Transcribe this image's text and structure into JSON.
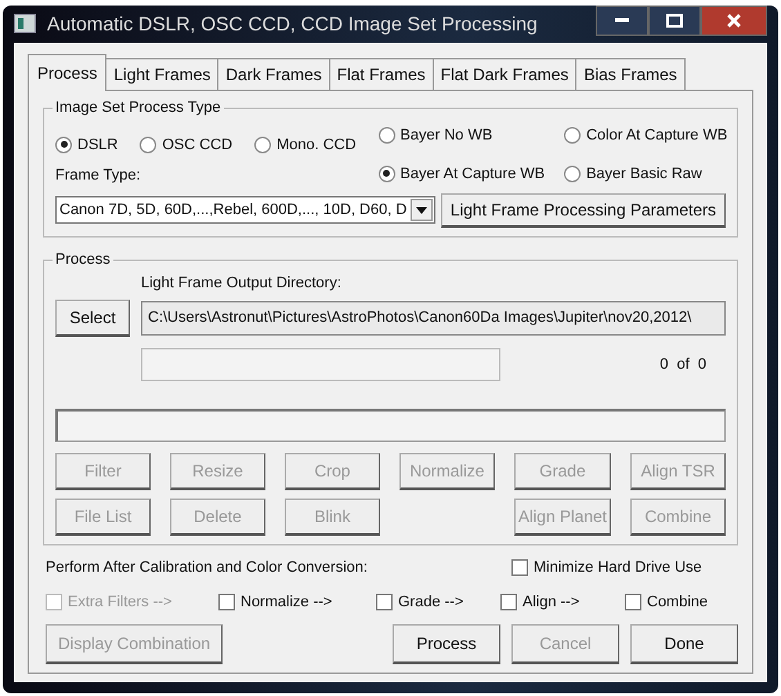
{
  "window": {
    "title": "Automatic DSLR, OSC CCD, CCD Image Set Processing"
  },
  "tabs": [
    {
      "label": "Process",
      "selected": true
    },
    {
      "label": "Light Frames",
      "selected": false
    },
    {
      "label": "Dark Frames",
      "selected": false
    },
    {
      "label": "Flat Frames",
      "selected": false
    },
    {
      "label": "Flat Dark Frames",
      "selected": false
    },
    {
      "label": "Bias Frames",
      "selected": false
    }
  ],
  "image_set_process_type": {
    "legend": "Image Set Process Type",
    "camera_types": [
      {
        "label": "DSLR",
        "selected": true
      },
      {
        "label": "OSC CCD",
        "selected": false
      },
      {
        "label": "Mono. CCD",
        "selected": false
      }
    ],
    "bayer_modes": [
      {
        "label": "Bayer No WB",
        "selected": false
      },
      {
        "label": "Color At Capture WB",
        "selected": false
      },
      {
        "label": "Bayer At Capture WB",
        "selected": true
      },
      {
        "label": "Bayer Basic Raw",
        "selected": false
      }
    ],
    "frame_type_label": "Frame Type:",
    "frame_type_value": "Canon 7D, 5D, 60D,...,Rebel, 600D,..., 10D, D60, D",
    "parameters_button": "Light Frame Processing Parameters"
  },
  "process": {
    "legend": "Process",
    "select_button": "Select",
    "output_dir_label": "Light Frame Output Directory:",
    "output_dir_value": "C:\\Users\\Astronut\\Pictures\\AstroPhotos\\Canon60Da Images\\Jupiter\\nov20,2012\\",
    "progress": {
      "level": 0
    },
    "counter": "0  of  0",
    "button_rows": [
      [
        {
          "label": "Filter",
          "disabled": true
        },
        {
          "label": "Resize",
          "disabled": true
        },
        {
          "label": "Crop",
          "disabled": true
        },
        {
          "label": "Normalize",
          "disabled": true
        },
        {
          "label": "Grade",
          "disabled": true
        },
        {
          "label": "Align TSR",
          "disabled": true
        }
      ],
      [
        {
          "label": "File List",
          "disabled": true
        },
        {
          "label": "Delete",
          "disabled": true
        },
        {
          "label": "Blink",
          "disabled": true
        },
        null,
        {
          "label": "Align Planet",
          "disabled": true
        },
        {
          "label": "Combine",
          "disabled": true
        }
      ]
    ]
  },
  "after_calibration": {
    "label": "Perform After Calibration and Color Conversion:",
    "minimize": {
      "label": "Minimize Hard Drive Use",
      "checked": false
    },
    "checks": [
      {
        "label": "Extra Filters -->",
        "checked": false,
        "disabled": true
      },
      {
        "label": "Normalize  -->",
        "checked": false,
        "disabled": false
      },
      {
        "label": "Grade -->",
        "checked": false,
        "disabled": false
      },
      {
        "label": "Align -->",
        "checked": false,
        "disabled": false
      },
      {
        "label": "Combine",
        "checked": false,
        "disabled": false
      }
    ],
    "display_combination": {
      "label": "Display Combination",
      "disabled": true
    }
  },
  "footer_buttons": [
    {
      "label": "Process",
      "disabled": false
    },
    {
      "label": "Cancel",
      "disabled": true
    },
    {
      "label": "Done",
      "disabled": false
    }
  ]
}
